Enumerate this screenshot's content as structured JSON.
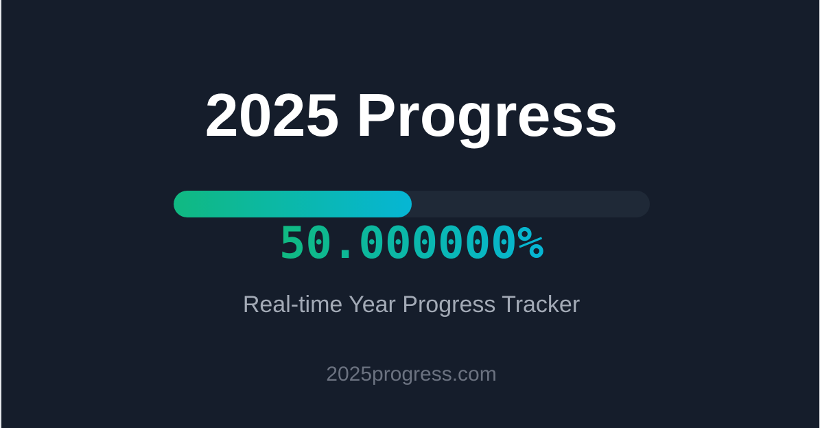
{
  "title": "2025 Progress",
  "progress": {
    "fraction": 0.5,
    "percent_label": "50.000000%",
    "track_color": "#1f2937",
    "gradient_start": "#10b981",
    "gradient_end": "#06b6d4"
  },
  "subtitle": "Real-time Year Progress Tracker",
  "site": "2025progress.com",
  "colors": {
    "background": "#151d2b",
    "title": "#ffffff",
    "subtitle": "#a3aab6",
    "site": "#6b7280"
  }
}
